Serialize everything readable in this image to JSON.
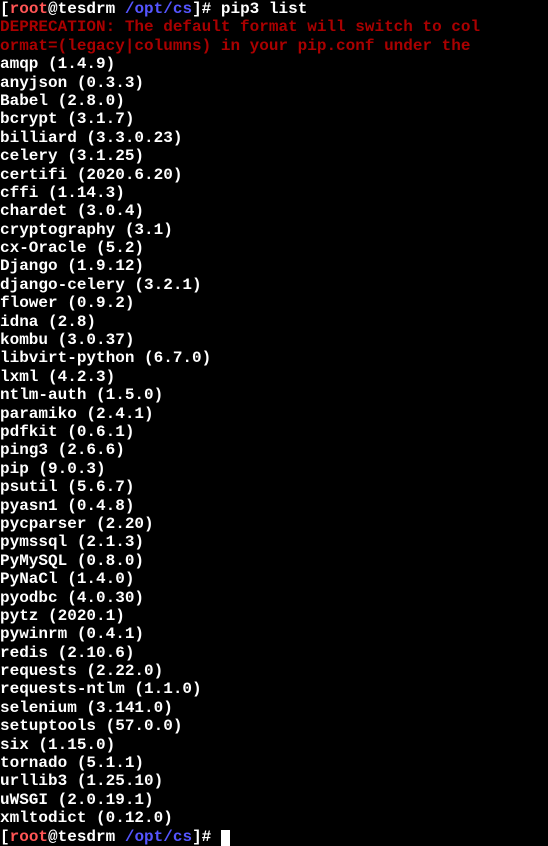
{
  "prompt1": {
    "user": "root",
    "host": "tesdrm",
    "path": "/opt/cs",
    "command": "pip3 list"
  },
  "deprecation_line1": "DEPRECATION: The default format will switch to col",
  "deprecation_line2": "ormat=(legacy|columns) in your pip.conf under the ",
  "packages": [
    "amqp (1.4.9)",
    "anyjson (0.3.3)",
    "Babel (2.8.0)",
    "bcrypt (3.1.7)",
    "billiard (3.3.0.23)",
    "celery (3.1.25)",
    "certifi (2020.6.20)",
    "cffi (1.14.3)",
    "chardet (3.0.4)",
    "cryptography (3.1)",
    "cx-Oracle (5.2)",
    "Django (1.9.12)",
    "django-celery (3.2.1)",
    "flower (0.9.2)",
    "idna (2.8)",
    "kombu (3.0.37)",
    "libvirt-python (6.7.0)",
    "lxml (4.2.3)",
    "ntlm-auth (1.5.0)",
    "paramiko (2.4.1)",
    "pdfkit (0.6.1)",
    "ping3 (2.6.6)",
    "pip (9.0.3)",
    "psutil (5.6.7)",
    "pyasn1 (0.4.8)",
    "pycparser (2.20)",
    "pymssql (2.1.3)",
    "PyMySQL (0.8.0)",
    "PyNaCl (1.4.0)",
    "pyodbc (4.0.30)",
    "pytz (2020.1)",
    "pywinrm (0.4.1)",
    "redis (2.10.6)",
    "requests (2.22.0)",
    "requests-ntlm (1.1.0)",
    "selenium (3.141.0)",
    "setuptools (57.0.0)",
    "six (1.15.0)",
    "tornado (5.1.1)",
    "urllib3 (1.25.10)",
    "uWSGI (2.0.19.1)",
    "xmltodict (0.12.0)"
  ],
  "prompt2": {
    "user": "root",
    "host": "tesdrm",
    "path": "/opt/cs"
  }
}
